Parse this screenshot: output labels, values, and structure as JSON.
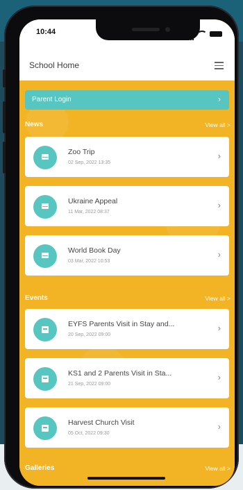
{
  "status": {
    "time": "10:44"
  },
  "appbar": {
    "title": "School Home"
  },
  "parent_login": {
    "label": "Parent Login"
  },
  "news": {
    "title": "News",
    "view_all": "View all >",
    "items": [
      {
        "title": "Zoo Trip",
        "date": "02 Sep, 2022 13:35"
      },
      {
        "title": "Ukraine Appeal",
        "date": "11 Mar, 2022 08:37"
      },
      {
        "title": "World Book Day",
        "date": "03 Mar, 2022 10:53"
      }
    ]
  },
  "events": {
    "title": "Events",
    "view_all": "View all >",
    "items": [
      {
        "title": "EYFS Parents Visit in Stay and...",
        "date": "20 Sep, 2022 09:00"
      },
      {
        "title": "KS1 and 2 Parents Visit in Sta...",
        "date": "21 Sep, 2022 09:00"
      },
      {
        "title": "Harvest Church Visit",
        "date": "05 Oct, 2022 09:30"
      }
    ]
  },
  "galleries": {
    "title": "Galleries",
    "view_all": "View all >"
  },
  "colors": {
    "accent": "#57c5c0",
    "background": "#f2b324"
  },
  "icons": {
    "news": "envelope-icon",
    "events": "calendar-icon"
  }
}
